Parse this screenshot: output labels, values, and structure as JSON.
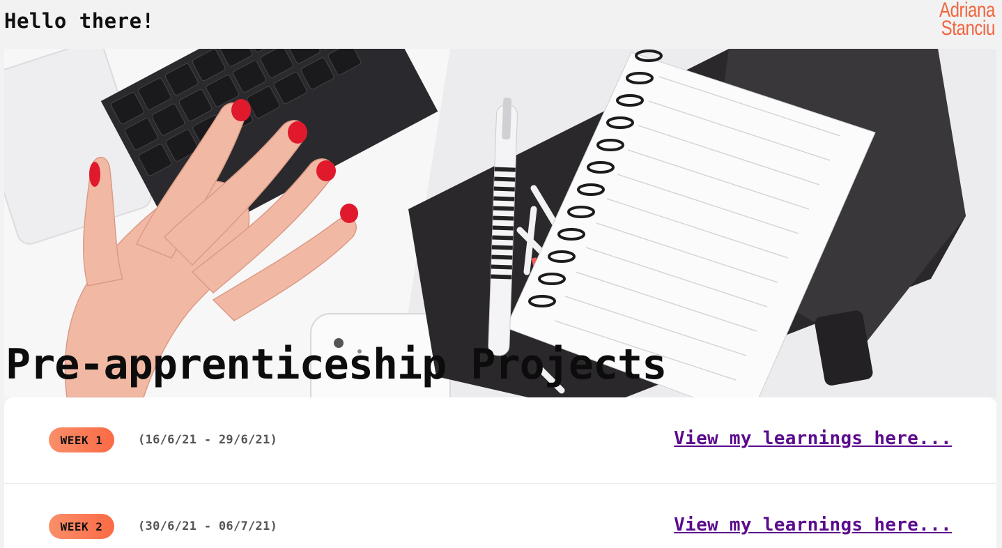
{
  "header": {
    "greeting": "Hello there!",
    "logo_line1": "Adriana",
    "logo_line2": "Stanciu"
  },
  "hero": {
    "title": "Pre-apprenticeship Projects",
    "image": "desk-with-laptop-hand-notebook-pen"
  },
  "weeks": [
    {
      "badge": "WEEK 1",
      "dates": "(16/6/21 - 29/6/21)",
      "link": "View my learnings here..."
    },
    {
      "badge": "WEEK 2",
      "dates": "(30/6/21 - 06/7/21)",
      "link": "View my learnings here..."
    }
  ],
  "colors": {
    "accent": "#f0653f",
    "badge_start": "#f98f6a",
    "badge_end": "#fb6a45",
    "link": "#5b0c8c"
  }
}
